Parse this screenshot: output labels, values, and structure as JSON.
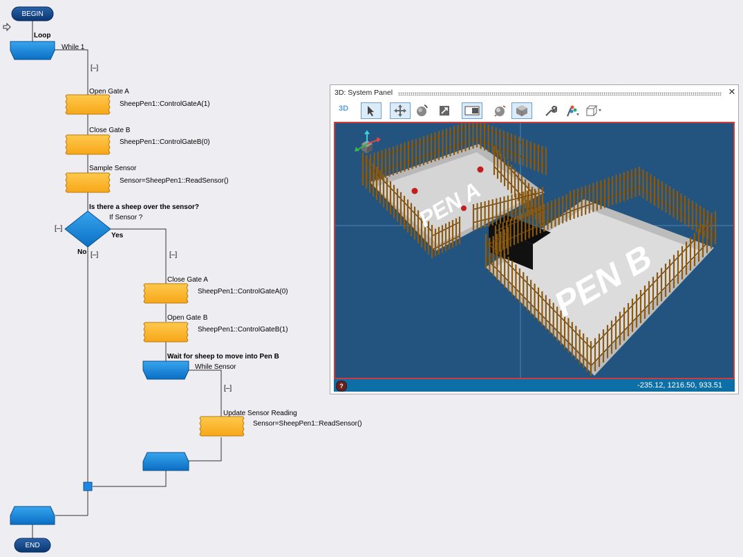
{
  "flowchart": {
    "begin_label": "BEGIN",
    "end_label": "END",
    "loop": {
      "caption": "Loop",
      "condition": "While 1",
      "toggle": "[–]"
    },
    "steps": [
      {
        "caption": "Open Gate A",
        "code": "SheepPen1::ControlGateA(1)"
      },
      {
        "caption": "Close Gate B",
        "code": "SheepPen1::ControlGateB(0)"
      },
      {
        "caption": "Sample Sensor",
        "code": "Sensor=SheepPen1::ReadSensor()"
      }
    ],
    "decision": {
      "caption": "Is there a sheep over the sensor?",
      "condition": "If  Sensor ?",
      "yes_label": "Yes",
      "no_label": "No",
      "toggle_left": "[–]",
      "toggle_no": "[–]",
      "toggle_yes": "[–]"
    },
    "yes_steps": [
      {
        "caption": "Close Gate A",
        "code": "SheepPen1::ControlGateA(0)"
      },
      {
        "caption": "Open Gate B",
        "code": "SheepPen1::ControlGateB(1)"
      }
    ],
    "inner_loop": {
      "caption": "Wait for sheep to move into Pen B",
      "condition": "While Sensor",
      "toggle": "[–]"
    },
    "inner_step": {
      "caption": "Update Sensor Reading",
      "code": "Sensor=SheepPen1::ReadSensor()"
    }
  },
  "panel": {
    "title": "3D: System Panel",
    "close_glyph": "✕",
    "tab_label": "3D",
    "toolbar": [
      {
        "name": "select-arrow-icon",
        "selected": true
      },
      {
        "name": "pan-move-icon",
        "selected": true
      },
      {
        "name": "rotate-icon",
        "selected": false
      },
      {
        "name": "zoom-icon",
        "selected": false
      },
      {
        "name": "camera-toggle-icon",
        "selected": true
      },
      {
        "name": "sphere-shading-icon",
        "selected": false
      },
      {
        "name": "cube-solid-icon",
        "selected": true
      },
      {
        "name": "wrench-icon",
        "selected": false
      },
      {
        "name": "paint-colors-icon",
        "selected": false
      },
      {
        "name": "wireframe-cube-icon",
        "selected": false
      }
    ],
    "scene": {
      "pen_a_label": "PEN A",
      "pen_b_label": "PEN B"
    },
    "help_glyph": "?",
    "coords": "-235.12, 1216.50, 933.51"
  },
  "colors": {
    "accent_blue": "#1a7fd0",
    "step_orange": "#ffb92e",
    "terminal_navy": "#0d3f7e",
    "viewport_bg": "#22547f",
    "fence_brown": "#8a5a12"
  }
}
